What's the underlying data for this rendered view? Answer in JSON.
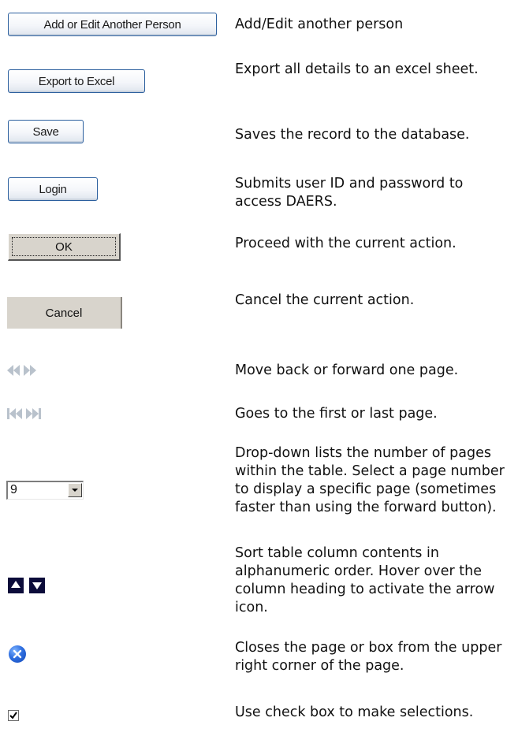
{
  "rows": [
    {
      "control_label": "Add or Edit Another Person",
      "description": "Add/Edit another person"
    },
    {
      "control_label": "Export to Excel",
      "description": "Export all details to an excel sheet."
    },
    {
      "control_label": "Save",
      "description": "Saves the record to the database."
    },
    {
      "control_label": "Login",
      "description": "Submits user ID and password to access DAERS."
    },
    {
      "control_label": "OK",
      "description": "Proceed with the current action."
    },
    {
      "control_label": "Cancel",
      "description": "Cancel the current action."
    },
    {
      "icon": "prev-next-page-icons",
      "description": "Move back or forward one page."
    },
    {
      "icon": "first-last-page-icons",
      "description": "Goes to the first or last page."
    },
    {
      "control_value": "9",
      "description": "Drop-down lists the number of pages within the table. Select a page number to display a specific page (sometimes faster than using the forward button)."
    },
    {
      "icon": "sort-up-down-icons",
      "description": "Sort table column contents in alphanumeric order. Hover over the column heading to activate the arrow icon."
    },
    {
      "icon": "close-circle-icon",
      "description": "Closes the page or box from the upper right corner of the page."
    },
    {
      "icon": "checked-checkbox-icon",
      "description": "Use check box to make selections."
    }
  ],
  "colors": {
    "button_border": "#2b5f9e",
    "sort_icon_bg": "#0c0c3a",
    "close_icon": "#2f6fe0",
    "nav_icon": "#b9c2cc"
  }
}
